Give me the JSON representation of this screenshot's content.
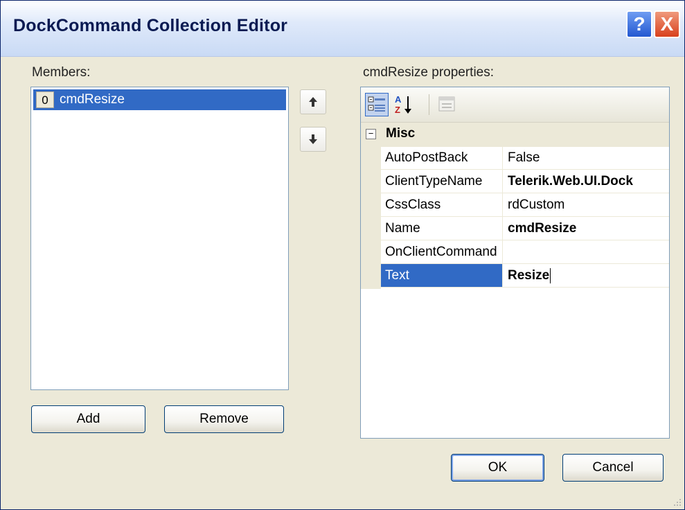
{
  "window": {
    "title": "DockCommand Collection Editor",
    "help_glyph": "?",
    "close_glyph": "X"
  },
  "members": {
    "label": "Members:",
    "items": [
      {
        "index": "0",
        "name": "cmdResize"
      }
    ],
    "add_label": "Add",
    "remove_label": "Remove",
    "move_up_icon": "arrow-up-icon",
    "move_down_icon": "arrow-down-icon"
  },
  "properties": {
    "label": "cmdResize properties:",
    "toolbar": {
      "categorized_icon": "categorized-icon",
      "alphabetical_icon": "alphabetical-icon",
      "property_pages_icon": "property-pages-icon"
    },
    "category": {
      "toggle": "−",
      "name": "Misc"
    },
    "rows": [
      {
        "name": "AutoPostBack",
        "value": "False"
      },
      {
        "name": "ClientTypeName",
        "value": "Telerik.Web.UI.Dock"
      },
      {
        "name": "CssClass",
        "value": "rdCustom"
      },
      {
        "name": "Name",
        "value": "cmdResize"
      },
      {
        "name": "OnClientCommand",
        "value": ""
      },
      {
        "name": "Text",
        "value": "Resize"
      }
    ]
  },
  "footer": {
    "ok_label": "OK",
    "cancel_label": "Cancel"
  },
  "colors": {
    "selection": "#316ac5",
    "dialog_bg": "#ece9d8",
    "title_text": "#0a1a52"
  }
}
